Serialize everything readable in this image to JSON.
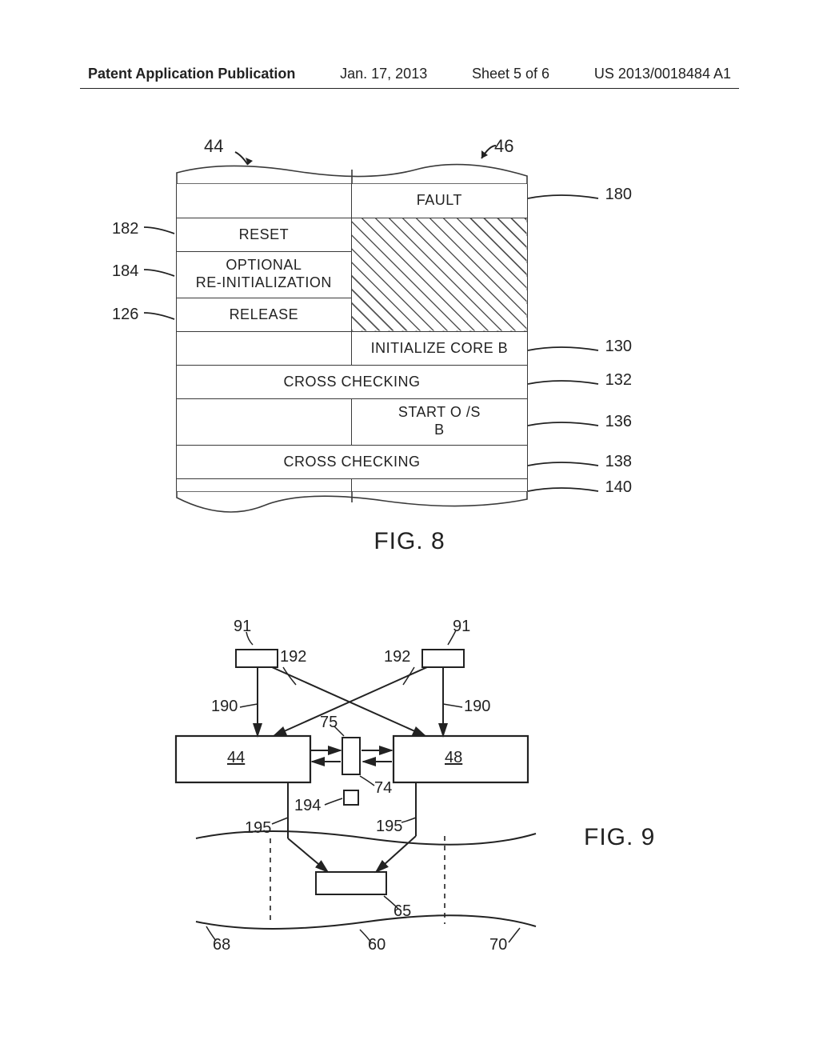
{
  "header": {
    "pub": "Patent Application Publication",
    "date": "Jan. 17, 2013",
    "sheet": "Sheet 5 of 6",
    "docnum": "US 2013/0018484 A1"
  },
  "fig8": {
    "top_left_num": "44",
    "top_right_num": "46",
    "left_labels": {
      "l182": "182",
      "l184": "184",
      "l126": "126"
    },
    "right_labels": {
      "r180": "180",
      "r130": "130",
      "r132": "132",
      "r136": "136",
      "r138": "138",
      "r140": "140"
    },
    "cells": {
      "fault": "FAULT",
      "reset": "RESET",
      "optional_reinit_l1": "OPTIONAL",
      "optional_reinit_l2": "RE-INITIALIZATION",
      "release": "RELEASE",
      "init_core_b": "INITIALIZE CORE B",
      "cross_checking_1": "CROSS CHECKING",
      "start_os_l1": "START O /S",
      "start_os_l2": "B",
      "cross_checking_2": "CROSS CHECKING"
    },
    "caption": "FIG. 8"
  },
  "fig9": {
    "nums": {
      "n91a": "91",
      "n91b": "91",
      "n192a": "192",
      "n192b": "192",
      "n190a": "190",
      "n190b": "190",
      "n44": "44",
      "n48": "48",
      "n75": "75",
      "n74": "74",
      "n194": "194",
      "n195a": "195",
      "n195b": "195",
      "n65": "65",
      "n68": "68",
      "n60": "60",
      "n70": "70"
    },
    "caption": "FIG. 9"
  }
}
